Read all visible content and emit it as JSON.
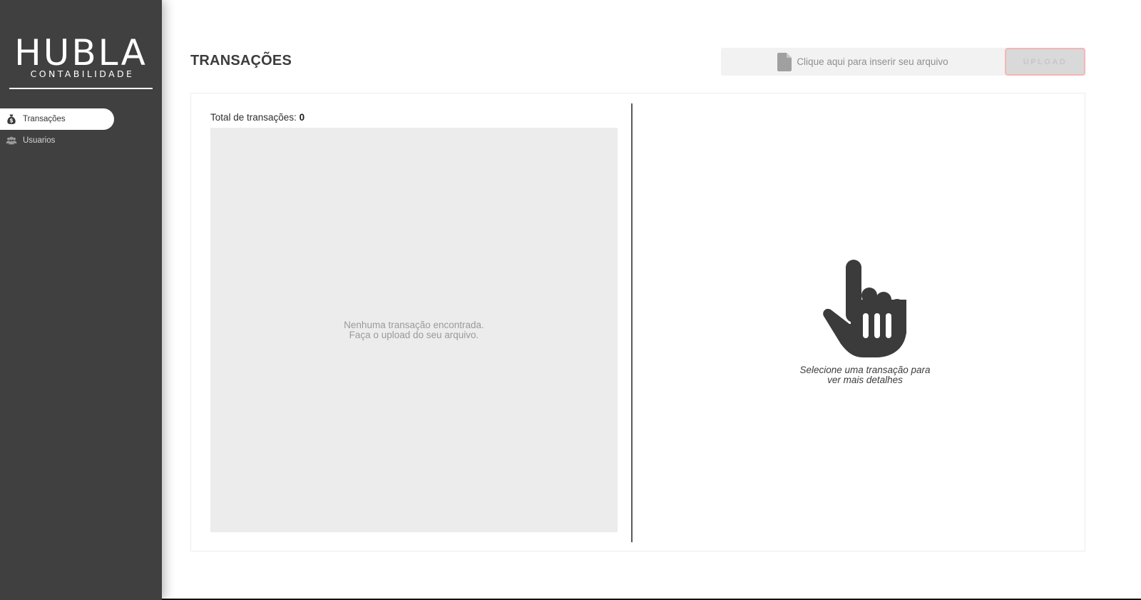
{
  "brand": {
    "name": "HUBLA",
    "subtitle": "CONTABILIDADE"
  },
  "sidebar": {
    "items": [
      {
        "label": "Transações",
        "icon": "money-bag-icon",
        "active": true
      },
      {
        "label": "Usuarios",
        "icon": "users-icon",
        "active": false
      }
    ]
  },
  "header": {
    "title": "TRANSAÇÕES",
    "file_placeholder": "Clique aqui para inserir seu arquivo",
    "upload_label": "UPLOAD"
  },
  "transactions": {
    "total_label": "Total de transações: ",
    "total_count": "0",
    "empty_line1": "Nenhuma transação encontrada.",
    "empty_line2": "Faça o upload do seu arquivo."
  },
  "details": {
    "icon": "pointing-hand-icon",
    "prompt_line1": "Selecione uma transação para",
    "prompt_line2": "ver mais detalhes"
  },
  "colors": {
    "sidebar_bg": "#404040",
    "accent_border": "#f3b6b6",
    "list_bg": "#ececec"
  }
}
